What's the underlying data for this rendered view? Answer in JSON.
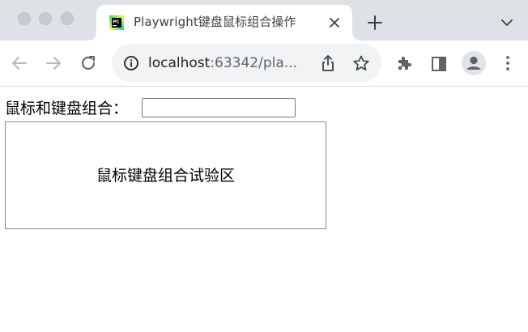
{
  "browser": {
    "tab": {
      "title": "Playwright键盘鼠标组合操作",
      "favicon": "pycharm-icon"
    },
    "address_bar": {
      "host": "localhost",
      "rest": ":63342/pla..."
    },
    "icons": [
      "back-arrow-icon",
      "forward-arrow-icon",
      "reload-icon",
      "info-icon",
      "share-icon",
      "star-icon",
      "extensions-icon",
      "side-panel-icon",
      "profile-icon",
      "menu-icon",
      "close-icon",
      "plus-icon",
      "chevron-down-icon"
    ],
    "accent_colors": {
      "tabstrip": "#dee1e6",
      "omnibox": "#f1f3f4",
      "icon": "#5f6368"
    }
  },
  "page": {
    "combo_label": "鼠标和键盘组合：",
    "combo_input_value": "",
    "test_area_text": "鼠标键盘组合试验区"
  }
}
